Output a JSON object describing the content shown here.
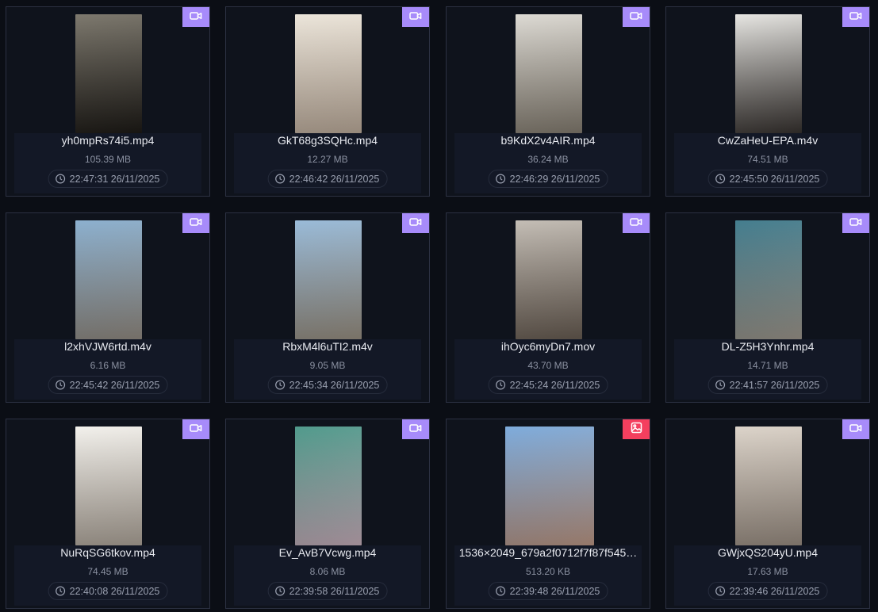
{
  "colors": {
    "background": "#0b0e15",
    "card": "#0f131c",
    "video_badge": "#a78bfa",
    "image_badge": "#f43f5e"
  },
  "files": [
    {
      "name": "yh0mpRs74i5.mp4",
      "size": "105.39 MB",
      "time": "22:47:31 26/11/2025",
      "type_icon": "video-icon",
      "thumb": [
        "#6f6a5e",
        "#1f1c18"
      ]
    },
    {
      "name": "GkT68g3SQHc.mp4",
      "size": "12.27 MB",
      "time": "22:46:42 26/11/2025",
      "type_icon": "video-icon",
      "thumb": [
        "#e9e2d6",
        "#c9b7a5"
      ]
    },
    {
      "name": "b9KdX2v4AIR.mp4",
      "size": "36.24 MB",
      "time": "22:46:29 26/11/2025",
      "type_icon": "video-icon",
      "thumb": [
        "#d9d6cf",
        "#8c8477"
      ]
    },
    {
      "name": "CwZaHeU-EPA.m4v",
      "size": "74.51 MB",
      "time": "22:45:50 26/11/2025",
      "type_icon": "video-icon",
      "thumb": [
        "#e4e3df",
        "#3a3532"
      ]
    },
    {
      "name": "l2xhVJW6rtd.m4v",
      "size": "6.16 MB",
      "time": "22:45:42 26/11/2025",
      "type_icon": "video-icon",
      "thumb": [
        "#7fa7c9",
        "#9c948a"
      ]
    },
    {
      "name": "RbxM4l6uTI2.m4v",
      "size": "9.05 MB",
      "time": "22:45:34 26/11/2025",
      "type_icon": "video-icon",
      "thumb": [
        "#8eb3d4",
        "#a29889"
      ]
    },
    {
      "name": "ihOyc6myDn7.mov",
      "size": "43.70 MB",
      "time": "22:45:24 26/11/2025",
      "type_icon": "video-icon",
      "thumb": [
        "#bdb6ad",
        "#6e6257"
      ]
    },
    {
      "name": "DL-Z5H3Ynhr.mp4",
      "size": "14.71 MB",
      "time": "22:41:57 26/11/2025",
      "type_icon": "video-icon",
      "thumb": [
        "#2f6f82",
        "#a9a196"
      ]
    },
    {
      "name": "NuRqSG6tkov.mp4",
      "size": "74.45 MB",
      "time": "22:40:08 26/11/2025",
      "type_icon": "video-icon",
      "thumb": [
        "#f1efea",
        "#b9afa3"
      ]
    },
    {
      "name": "Ev_AvB7Vcwg.mp4",
      "size": "8.06 MB",
      "time": "22:39:58 26/11/2025",
      "type_icon": "video-icon",
      "thumb": [
        "#3d8f7f",
        "#d3b9c6"
      ]
    },
    {
      "name": "1536×2049_679a2f0712f7f87f545…",
      "size": "513.20 KB",
      "time": "22:39:48 26/11/2025",
      "type_icon": "image-icon",
      "thumb": [
        "#6fa2d8",
        "#c8a18d"
      ]
    },
    {
      "name": "GWjxQS204yU.mp4",
      "size": "17.63 MB",
      "time": "22:39:46 26/11/2025",
      "type_icon": "video-icon",
      "thumb": [
        "#d8cfc4",
        "#a3968a"
      ]
    }
  ]
}
